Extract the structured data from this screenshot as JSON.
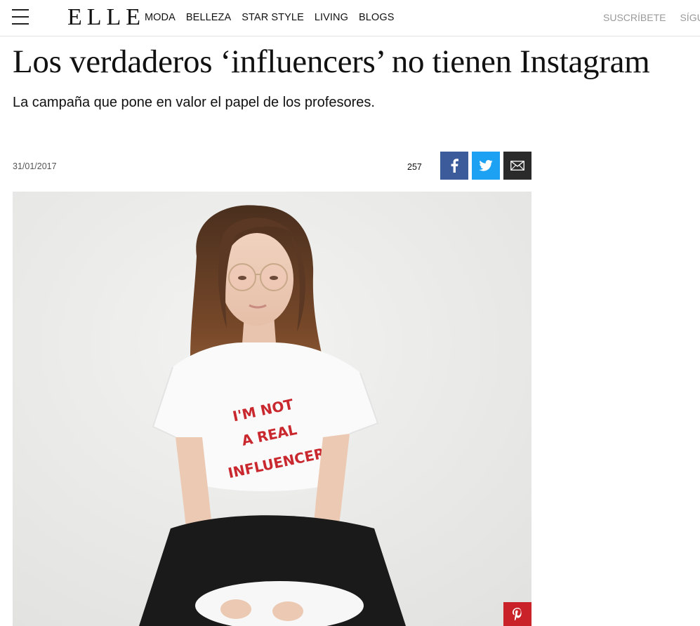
{
  "header": {
    "logo": "ELLE",
    "nav": [
      "MODA",
      "BELLEZA",
      "STAR STYLE",
      "LIVING",
      "BLOGS"
    ],
    "subscribe_label": "SUSCRÍBETE",
    "follow_label": "SÍGUE"
  },
  "article": {
    "title": "Los verdaderos ‘influencers’ no tienen Instagram",
    "subtitle": "La campaña que pone en valor el papel de los profesores.",
    "date": "31/01/2017",
    "share_count": "257"
  },
  "hero": {
    "shirt_text": [
      "I'M NOT",
      "A REAL",
      "INFLUENCER"
    ]
  },
  "icons": {
    "menu": "hamburger-icon",
    "facebook": "facebook-icon",
    "twitter": "twitter-icon",
    "mail": "mail-icon",
    "pinterest": "pinterest-icon"
  },
  "colors": {
    "facebook": "#3b5b9a",
    "twitter": "#1da1f2",
    "mail": "#2a2a2a",
    "pinterest": "#c92228",
    "shirt_print": "#c8282e"
  }
}
